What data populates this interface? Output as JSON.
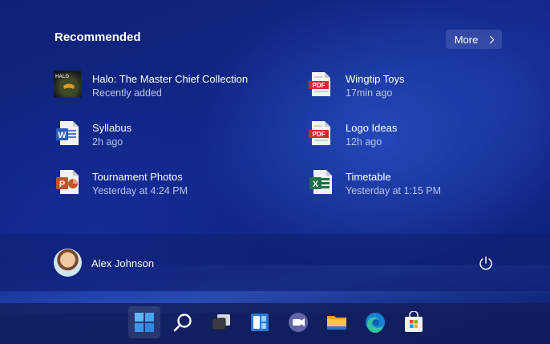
{
  "recommended": {
    "title": "Recommended",
    "more_label": "More",
    "items": [
      {
        "name": "Halo: The Master Chief Collection",
        "sub": "Recently added",
        "icon": "halo-game-icon"
      },
      {
        "name": "Wingtip Toys",
        "sub": "17min ago",
        "icon": "pdf-file-icon"
      },
      {
        "name": "Syllabus",
        "sub": "2h ago",
        "icon": "word-file-icon"
      },
      {
        "name": "Logo Ideas",
        "sub": "12h ago",
        "icon": "pdf-file-icon"
      },
      {
        "name": "Tournament Photos",
        "sub": "Yesterday at 4:24 PM",
        "icon": "powerpoint-file-icon"
      },
      {
        "name": "Timetable",
        "sub": "Yesterday at 1:15 PM",
        "icon": "excel-file-icon"
      }
    ]
  },
  "user": {
    "name": "Alex Johnson"
  },
  "taskbar": {
    "icons": [
      "start-icon",
      "search-icon",
      "task-view-icon",
      "widgets-icon",
      "teams-chat-icon",
      "file-explorer-icon",
      "edge-icon",
      "store-icon"
    ]
  },
  "colors": {
    "pdf": "#d4272e",
    "word": "#2b5fb8",
    "powerpoint": "#c9502a",
    "excel": "#1e7145",
    "accent": "#4aa3f0"
  }
}
